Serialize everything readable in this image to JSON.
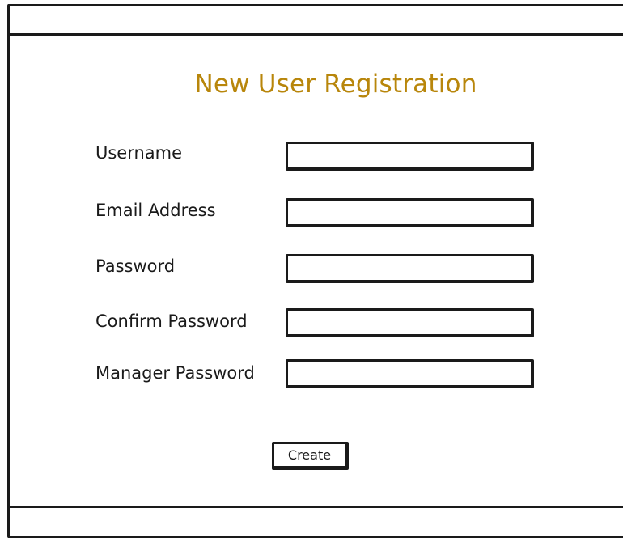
{
  "form": {
    "title": "New User Registration",
    "fields": [
      {
        "label": "Username",
        "value": ""
      },
      {
        "label": "Email Address",
        "value": ""
      },
      {
        "label": "Password",
        "value": ""
      },
      {
        "label": "Confirm Password",
        "value": ""
      },
      {
        "label": "Manager Password",
        "value": ""
      }
    ],
    "submit_label": "Create"
  },
  "colors": {
    "title": "#b8860b",
    "border": "#1a1a1a",
    "background": "#ffffff"
  }
}
